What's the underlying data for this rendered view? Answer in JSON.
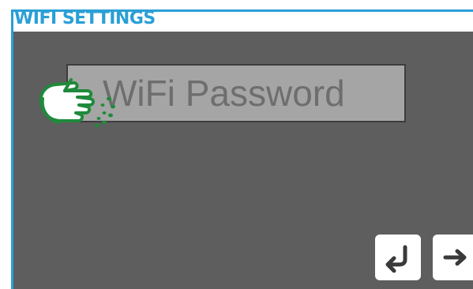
{
  "header": {
    "title": "WIFI SETTINGS"
  },
  "screen": {
    "section_title": "WIFI PASSWORD",
    "password_field": {
      "value": "",
      "placeholder": "WiFi Password"
    }
  },
  "nav": {
    "back_icon": "return-arrow-icon",
    "next_icon": "right-arrow-icon"
  },
  "colors": {
    "accent": "#2a9fd6",
    "panel_bg": "#5e5e5e",
    "input_bg": "#a5a5a5",
    "hint_green": "#1f8a3b"
  }
}
